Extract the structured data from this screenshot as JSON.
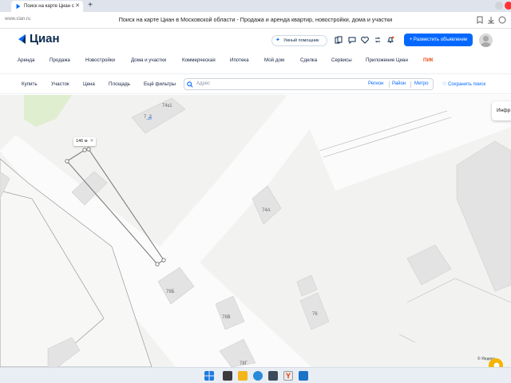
{
  "browser": {
    "tab_title": "Поиск на карте Циан с",
    "new_tab": "+",
    "url": "www.cian.ru",
    "page_title": "Поиск на карте Циан в Московской области - Продажа и аренда квартир, новостройки, дома и участки"
  },
  "header": {
    "logo": "Циан",
    "assistant": "Умный помощник",
    "post_button": "+ Разместить объявление"
  },
  "nav": {
    "items": [
      "Аренда",
      "Продажа",
      "Новостройки",
      "Дома и участки",
      "Коммерческая",
      "Ипотека",
      "Мой дом",
      "Сделка",
      "Сервисы",
      "Приложение Циан"
    ],
    "pik": "ПИК"
  },
  "filters": {
    "buy": "Купить",
    "type": "Участок",
    "price": "Цена",
    "area": "Площадь",
    "more": "Ещё фильтры",
    "search_placeholder": "Адрес",
    "region": "Регион",
    "district": "Район",
    "metro": "Метро",
    "save_search": "Сохранить поиск"
  },
  "map": {
    "info": "Инфр",
    "measure": "146 м",
    "copyright": "© Яндекс",
    "buildings": [
      "74к1",
      "74А",
      "78Б",
      "78В",
      "76",
      "78Г"
    ],
    "building_partial": "7_2"
  },
  "colors": {
    "brand_blue": "#0468ff",
    "pik_orange": "#e8501a",
    "building": "#e3e3e3"
  }
}
